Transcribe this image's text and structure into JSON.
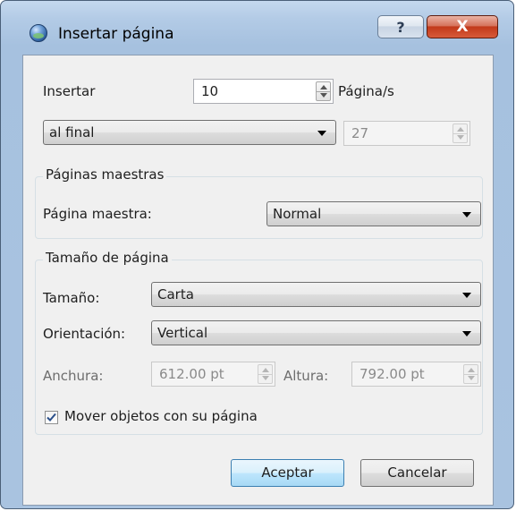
{
  "window": {
    "title": "Insertar página",
    "help_label": "?",
    "close_label": "X",
    "icon": "app-globe-icon"
  },
  "insert": {
    "label": "Insertar",
    "count": "10",
    "unit_label": "Página/s",
    "position_selected": "al final",
    "page_number": "27"
  },
  "master_pages": {
    "group_title": "Páginas maestras",
    "label": "Página maestra:",
    "selected": "Normal"
  },
  "page_size": {
    "group_title": "Tamaño de página",
    "size_label": "Tamaño:",
    "size_selected": "Carta",
    "orientation_label": "Orientación:",
    "orientation_selected": "Vertical",
    "width_label": "Anchura:",
    "width_value": "612.00 pt",
    "height_label": "Altura:",
    "height_value": "792.00 pt",
    "move_objects_label": "Mover objetos con su página",
    "move_objects_checked": true
  },
  "buttons": {
    "accept": "Aceptar",
    "cancel": "Cancelar"
  }
}
